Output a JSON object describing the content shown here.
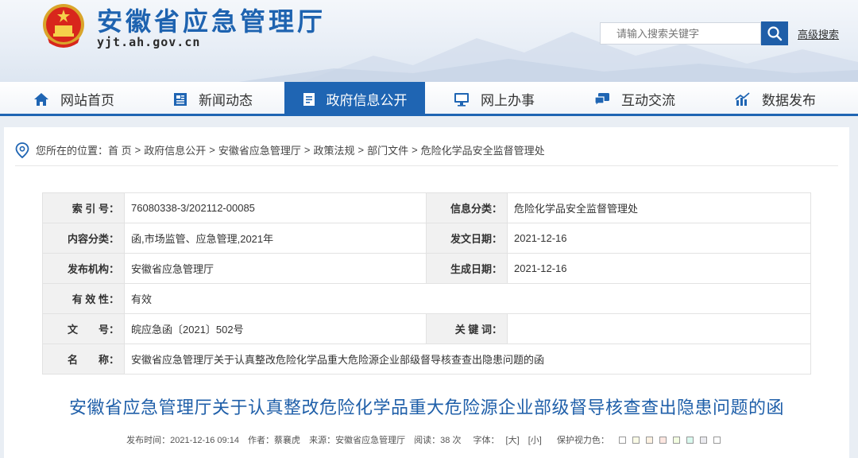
{
  "header": {
    "title": "安徽省应急管理厅",
    "domain": "yjt.ah.gov.cn",
    "search_placeholder": "请输入搜索关键字",
    "advanced_search": "高级搜索"
  },
  "nav": {
    "items": [
      {
        "label": "网站首页",
        "icon": "home-icon"
      },
      {
        "label": "新闻动态",
        "icon": "news-icon"
      },
      {
        "label": "政府信息公开",
        "icon": "document-icon",
        "active": true
      },
      {
        "label": "网上办事",
        "icon": "monitor-icon"
      },
      {
        "label": "互动交流",
        "icon": "chat-icon"
      },
      {
        "label": "数据发布",
        "icon": "chart-icon"
      }
    ]
  },
  "breadcrumb": {
    "prefix": "您所在的位置：",
    "items": [
      "首 页",
      "政府信息公开",
      "安徽省应急管理厅",
      "政策法规",
      "部门文件",
      "危险化学品安全监督管理处"
    ]
  },
  "meta": {
    "index_label": "索 引 号：",
    "index_value": "76080338-3/202112-00085",
    "category_label": "信息分类：",
    "category_value": "危险化学品安全监督管理处",
    "content_label": "内容分类：",
    "content_value": "函,市场监管、应急管理,2021年",
    "issue_date_label": "发文日期：",
    "issue_date_value": "2021-12-16",
    "publisher_label": "发布机构：",
    "publisher_value": "安徽省应急管理厅",
    "gen_date_label": "生成日期：",
    "gen_date_value": "2021-12-16",
    "validity_label": "有 效 性：",
    "validity_value": "有效",
    "docno_label": "文　　号：",
    "docno_value": "皖应急函〔2021〕502号",
    "keywords_label": "关 键 词：",
    "keywords_value": "",
    "name_label": "名　　称：",
    "name_value": "安徽省应急管理厅关于认真整改危险化学品重大危险源企业部级督导核查查出隐患问题的函"
  },
  "document": {
    "title": "安徽省应急管理厅关于认真整改危险化学品重大危险源企业部级督导核查查出隐患问题的函",
    "publish_time": "发布时间：2021-12-16 09:14",
    "author": "作者：蔡襄虎",
    "source": "来源：安徽省应急管理厅",
    "reads": "阅读：38 次",
    "font_label": "字体：",
    "font_large": "[大]",
    "font_small": "[小]",
    "eye_label": "保护视力色：",
    "eye_colors": [
      "#ffffff",
      "#fafbe6",
      "#fff2e2",
      "#fde6e0",
      "#f3ffe1",
      "#dafaef",
      "#eaeaef",
      "#ffffff"
    ]
  },
  "colors": {
    "brand_blue": "#1f65b3",
    "title_blue": "#1f5fa9"
  }
}
